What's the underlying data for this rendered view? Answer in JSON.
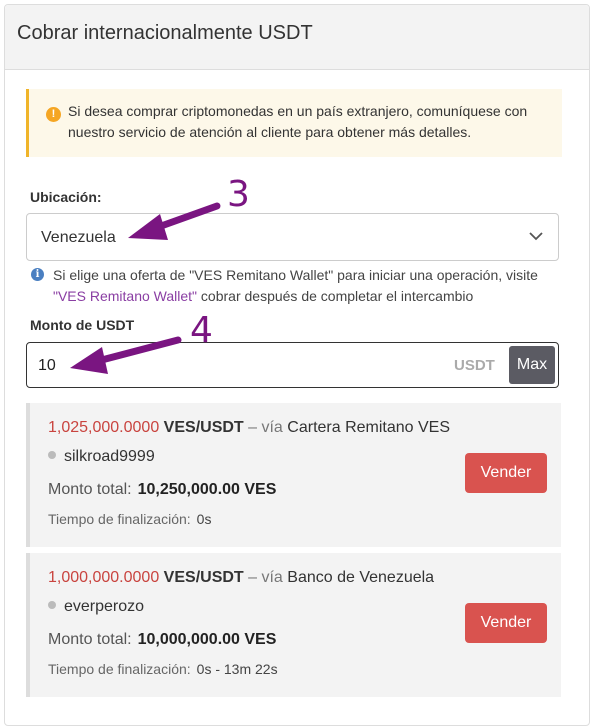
{
  "panel": {
    "title": "Cobrar internacionalmente USDT"
  },
  "alert": {
    "icon": "warning-icon",
    "text": "Si desea comprar criptomonedas en un país extranjero, comuníquese con nuestro servicio de atención al cliente para obtener más detalles."
  },
  "location": {
    "label": "Ubicación:",
    "value": "Venezuela",
    "info_before": "Si elige una oferta de \"VES Remitano Wallet\" para iniciar una operación, visite",
    "info_link": "\"VES Remitano Wallet\"",
    "info_after": "cobrar después de completar el intercambio"
  },
  "amount": {
    "label": "Monto de USDT",
    "value": "10",
    "unit": "USDT",
    "max_label": "Max"
  },
  "offers": [
    {
      "price": "1,025,000.0000",
      "pair": "VES/USDT",
      "via": "– vía",
      "method": "Cartera Remitano VES",
      "merchant": "silkroad9999",
      "total_label": "Monto total:",
      "total_value": "10,250,000.00 VES",
      "time_label": "Tiempo de finalización:",
      "time_value": "0s",
      "button": "Vender"
    },
    {
      "price": "1,000,000.0000",
      "pair": "VES/USDT",
      "via": "– vía",
      "method": "Banco de Venezuela",
      "merchant": "everperozo",
      "total_label": "Monto total:",
      "total_value": "10,000,000.00 VES",
      "time_label": "Tiempo de finalización:",
      "time_value": "0s - 13m 22s",
      "button": "Vender"
    }
  ],
  "annotations": {
    "arrow_3": "3",
    "arrow_4": "4",
    "color": "#7a1581"
  }
}
